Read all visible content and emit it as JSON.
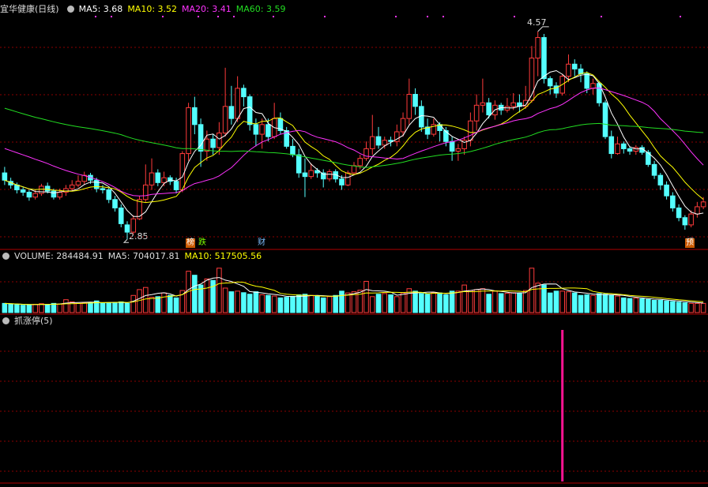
{
  "main_panel": {
    "title": "宜华健康(日线)",
    "ma_labels": [
      {
        "text": "MA5: 3.68",
        "color": "#ffffff"
      },
      {
        "text": "MA10: 3.52",
        "color": "#ffff00"
      },
      {
        "text": "MA20: 3.41",
        "color": "#ff33ff"
      },
      {
        "text": "MA60: 3.59",
        "color": "#22dd22"
      }
    ],
    "high_label": "4.57",
    "low_label": "2.85",
    "event_tags": [
      {
        "text": "榜",
        "bg": "#cc5a00",
        "color": "#ffffff"
      },
      {
        "text": "跌",
        "bg": "#000000",
        "color": "#7fff00"
      },
      {
        "text": "财",
        "bg": "#000000",
        "color": "#7fbfff"
      },
      {
        "text": "预",
        "bg": "#cc5a00",
        "color": "#ffffff"
      }
    ]
  },
  "volume_panel": {
    "name": "VOLUME: 284484.91",
    "ma5": "MA5: 704017.81",
    "ma10": "MA10: 517505.56"
  },
  "indicator_panel": {
    "name": "抓涨停(5)"
  },
  "colors": {
    "up": "#ff3b3b",
    "down": "#54ffff",
    "ma5": "#ffffff",
    "ma10": "#ffff00",
    "ma20": "#ff33ff",
    "ma60": "#22dd22",
    "signal": "#ff1493",
    "grid": "#8b0000"
  },
  "chart_data": {
    "type": "candlestick",
    "price_ylim": [
      2.78,
      4.7
    ],
    "high": 4.57,
    "low": 2.85,
    "latest_ma": {
      "MA5": 3.68,
      "MA10": 3.52,
      "MA20": 3.41,
      "MA60": 3.59
    },
    "candles": [
      [
        3.4,
        3.34,
        3.45,
        3.3
      ],
      [
        3.33,
        3.3,
        3.36,
        3.27
      ],
      [
        3.3,
        3.26,
        3.32,
        3.23
      ],
      [
        3.26,
        3.24,
        3.28,
        3.21
      ],
      [
        3.24,
        3.2,
        3.26,
        3.17
      ],
      [
        3.2,
        3.23,
        3.26,
        3.18
      ],
      [
        3.23,
        3.29,
        3.31,
        3.21
      ],
      [
        3.29,
        3.25,
        3.32,
        3.23
      ],
      [
        3.25,
        3.2,
        3.27,
        3.18
      ],
      [
        3.2,
        3.24,
        3.27,
        3.18
      ],
      [
        3.24,
        3.27,
        3.3,
        3.21
      ],
      [
        3.27,
        3.3,
        3.34,
        3.25
      ],
      [
        3.3,
        3.33,
        3.38,
        3.28
      ],
      [
        3.33,
        3.38,
        3.41,
        3.3
      ],
      [
        3.38,
        3.34,
        3.4,
        3.31
      ],
      [
        3.34,
        3.27,
        3.36,
        3.24
      ],
      [
        3.27,
        3.26,
        3.3,
        3.23
      ],
      [
        3.26,
        3.18,
        3.28,
        3.15
      ],
      [
        3.18,
        3.11,
        3.21,
        3.08
      ],
      [
        3.11,
        2.98,
        3.14,
        2.95
      ],
      [
        2.97,
        2.91,
        3.0,
        2.85
      ],
      [
        2.91,
        3.02,
        3.05,
        2.89
      ],
      [
        3.02,
        3.18,
        3.21,
        3.01
      ],
      [
        3.18,
        3.3,
        3.47,
        3.16
      ],
      [
        3.3,
        3.4,
        3.52,
        3.26
      ],
      [
        3.4,
        3.32,
        3.43,
        3.29
      ],
      [
        3.32,
        3.36,
        3.41,
        3.29
      ],
      [
        3.36,
        3.33,
        3.38,
        3.3
      ],
      [
        3.33,
        3.26,
        3.36,
        3.23
      ],
      [
        3.26,
        3.56,
        3.58,
        3.24
      ],
      [
        3.56,
        3.94,
        3.98,
        3.5
      ],
      [
        3.94,
        3.8,
        4.03,
        3.72
      ],
      [
        3.8,
        3.58,
        3.85,
        3.45
      ],
      [
        3.58,
        3.68,
        3.75,
        3.5
      ],
      [
        3.68,
        3.61,
        3.72,
        3.55
      ],
      [
        3.61,
        3.73,
        3.82,
        3.55
      ],
      [
        3.73,
        3.95,
        4.27,
        3.7
      ],
      [
        3.95,
        3.85,
        4.12,
        3.8
      ],
      [
        3.85,
        4.1,
        4.2,
        3.82
      ],
      [
        4.1,
        4.03,
        4.13,
        3.95
      ],
      [
        4.03,
        3.8,
        4.05,
        3.75
      ],
      [
        3.8,
        3.72,
        3.85,
        3.62
      ],
      [
        3.72,
        3.8,
        3.85,
        3.6
      ],
      [
        3.8,
        3.7,
        3.85,
        3.66
      ],
      [
        3.7,
        3.85,
        3.98,
        3.68
      ],
      [
        3.85,
        3.75,
        3.9,
        3.72
      ],
      [
        3.75,
        3.62,
        3.78,
        3.6
      ],
      [
        3.62,
        3.55,
        3.68,
        3.53
      ],
      [
        3.55,
        3.4,
        3.6,
        3.36
      ],
      [
        3.4,
        3.37,
        3.52,
        3.2
      ],
      [
        3.37,
        3.42,
        3.48,
        3.35
      ],
      [
        3.42,
        3.4,
        3.44,
        3.36
      ],
      [
        3.4,
        3.35,
        3.43,
        3.28
      ],
      [
        3.35,
        3.41,
        3.43,
        3.33
      ],
      [
        3.41,
        3.35,
        3.43,
        3.32
      ],
      [
        3.35,
        3.3,
        3.38,
        3.26
      ],
      [
        3.3,
        3.4,
        3.42,
        3.29
      ],
      [
        3.4,
        3.46,
        3.49,
        3.38
      ],
      [
        3.46,
        3.52,
        3.55,
        3.43
      ],
      [
        3.52,
        3.6,
        3.66,
        3.5
      ],
      [
        3.6,
        3.7,
        3.88,
        3.55
      ],
      [
        3.7,
        3.63,
        3.78,
        3.6
      ],
      [
        3.63,
        3.67,
        3.7,
        3.6
      ],
      [
        3.67,
        3.66,
        3.7,
        3.62
      ],
      [
        3.66,
        3.74,
        3.8,
        3.62
      ],
      [
        3.74,
        3.85,
        3.9,
        3.7
      ],
      [
        3.85,
        4.05,
        4.18,
        3.8
      ],
      [
        4.05,
        3.95,
        4.1,
        3.88
      ],
      [
        3.95,
        3.78,
        4.0,
        3.74
      ],
      [
        3.78,
        3.72,
        3.85,
        3.68
      ],
      [
        3.72,
        3.8,
        3.85,
        3.7
      ],
      [
        3.8,
        3.75,
        3.82,
        3.66
      ],
      [
        3.75,
        3.66,
        3.78,
        3.62
      ],
      [
        3.66,
        3.58,
        3.7,
        3.5
      ],
      [
        3.58,
        3.6,
        3.64,
        3.5
      ],
      [
        3.6,
        3.67,
        3.7,
        3.55
      ],
      [
        3.67,
        3.83,
        3.9,
        3.62
      ],
      [
        3.83,
        3.96,
        4.05,
        3.75
      ],
      [
        3.96,
        3.98,
        4.18,
        3.9
      ],
      [
        3.98,
        3.88,
        4.02,
        3.85
      ],
      [
        3.88,
        3.96,
        4.0,
        3.84
      ],
      [
        3.96,
        3.92,
        3.98,
        3.88
      ],
      [
        3.92,
        3.95,
        4.02,
        3.9
      ],
      [
        3.95,
        3.98,
        4.06,
        3.92
      ],
      [
        3.98,
        3.95,
        4.05,
        3.9
      ],
      [
        3.95,
        4.0,
        4.12,
        3.93
      ],
      [
        4.0,
        4.35,
        4.45,
        3.98
      ],
      [
        4.35,
        4.52,
        4.57,
        4.2
      ],
      [
        4.52,
        4.18,
        4.55,
        4.14
      ],
      [
        4.18,
        4.12,
        4.2,
        4.05
      ],
      [
        4.12,
        4.06,
        4.15,
        4.02
      ],
      [
        4.06,
        4.2,
        4.22,
        4.04
      ],
      [
        4.2,
        4.3,
        4.38,
        4.15
      ],
      [
        4.3,
        4.26,
        4.34,
        4.2
      ],
      [
        4.26,
        4.22,
        4.3,
        4.15
      ],
      [
        4.22,
        4.1,
        4.24,
        4.06
      ],
      [
        4.1,
        4.14,
        4.18,
        4.05
      ],
      [
        4.14,
        3.98,
        4.16,
        3.95
      ],
      [
        3.98,
        3.7,
        4.0,
        3.68
      ],
      [
        3.7,
        3.56,
        3.75,
        3.52
      ],
      [
        3.56,
        3.64,
        3.7,
        3.55
      ],
      [
        3.64,
        3.6,
        3.66,
        3.56
      ],
      [
        3.6,
        3.58,
        3.62,
        3.55
      ],
      [
        3.58,
        3.61,
        3.63,
        3.55
      ],
      [
        3.61,
        3.57,
        3.63,
        3.55
      ],
      [
        3.57,
        3.47,
        3.59,
        3.45
      ],
      [
        3.47,
        3.38,
        3.5,
        3.35
      ],
      [
        3.38,
        3.3,
        3.4,
        3.26
      ],
      [
        3.3,
        3.21,
        3.33,
        3.18
      ],
      [
        3.21,
        3.11,
        3.24,
        3.08
      ],
      [
        3.11,
        3.03,
        3.14,
        3.0
      ],
      [
        3.03,
        2.97,
        3.05,
        2.93
      ],
      [
        2.97,
        3.06,
        3.09,
        2.95
      ],
      [
        3.06,
        3.12,
        3.16,
        3.03
      ],
      [
        3.12,
        3.16,
        3.2,
        3.1
      ]
    ],
    "volume": [
      300,
      280,
      260,
      240,
      250,
      270,
      290,
      260,
      300,
      280,
      420,
      350,
      300,
      320,
      330,
      380,
      300,
      320,
      330,
      350,
      300,
      560,
      750,
      820,
      500,
      520,
      640,
      560,
      480,
      720,
      1350,
      1220,
      900,
      1100,
      1050,
      1450,
      800,
      680,
      700,
      650,
      600,
      680,
      580,
      560,
      540,
      480,
      500,
      530,
      580,
      600,
      560,
      540,
      480,
      520,
      560,
      700,
      640,
      680,
      730,
      1020,
      520,
      600,
      620,
      580,
      520,
      640,
      780,
      700,
      620,
      600,
      650,
      640,
      580,
      700,
      700,
      900,
      720,
      750,
      780,
      600,
      700,
      620,
      630,
      650,
      620,
      720,
      1450,
      960,
      900,
      640,
      700,
      700,
      680,
      640,
      560,
      580,
      560,
      620,
      600,
      560,
      540,
      480,
      460,
      470,
      450,
      430,
      400,
      400,
      380,
      360,
      340,
      320,
      300,
      300,
      300
    ],
    "volume_ylim": [
      0,
      1650
    ],
    "indicator": {
      "name": "抓涨停",
      "signal_index": 91,
      "ylim": [
        0,
        1
      ]
    }
  }
}
